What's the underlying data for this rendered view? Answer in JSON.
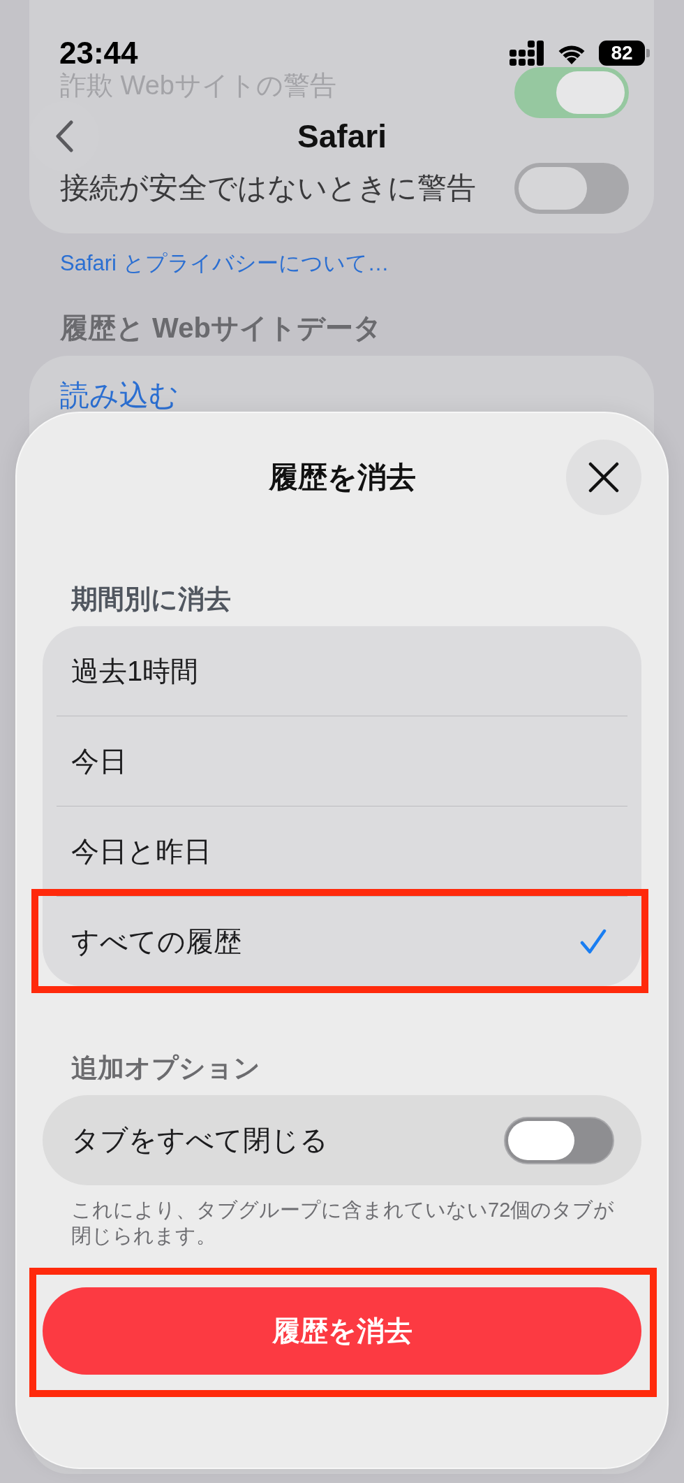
{
  "status_bar": {
    "time": "23:44",
    "battery": "82"
  },
  "nav": {
    "title": "Safari"
  },
  "settings": {
    "rows": [
      {
        "label": "詐欺 Webサイトの警告",
        "on": true,
        "faded": true
      },
      {
        "label": "接続が安全ではないときに警告",
        "on": false,
        "faded": false
      }
    ],
    "link": "Safari とプライバシーについて…",
    "section_header": "履歴と Webサイトデータ",
    "items": [
      "読み込む"
    ]
  },
  "sheet": {
    "title": "履歴を消去",
    "period_header": "期間別に消去",
    "options": [
      {
        "label": "過去1時間",
        "selected": false,
        "highlighted": false
      },
      {
        "label": "今日",
        "selected": false,
        "highlighted": false
      },
      {
        "label": "今日と昨日",
        "selected": false,
        "highlighted": false
      },
      {
        "label": "すべての履歴",
        "selected": true,
        "highlighted": true
      }
    ],
    "extra_header": "追加オプション",
    "toggle": {
      "label": "タブをすべて閉じる",
      "on": false
    },
    "footnote": "これにより、タブグループに含まれていない72個のタブが閉じられます。",
    "clear_button": {
      "label": "履歴を消去",
      "highlighted": true
    }
  }
}
